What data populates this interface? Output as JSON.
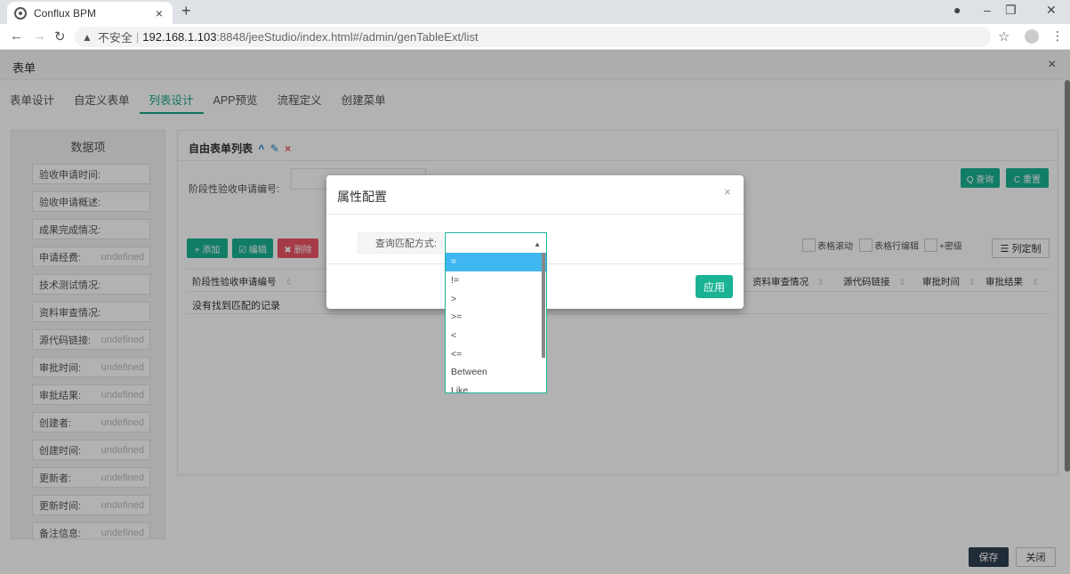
{
  "browser": {
    "tab_title": "Conflux BPM",
    "tab_close": "×",
    "new_tab": "+",
    "insecure_label": "不安全",
    "url_host": "192.168.1.103",
    "url_path": ":8848/jeeStudio/index.html#/admin/genTableExt/list"
  },
  "layer": {
    "title": "表单",
    "close": "×"
  },
  "tabs": [
    "表单设计",
    "自定义表单",
    "列表设计",
    "APP预览",
    "流程定义",
    "创建菜单"
  ],
  "left_panel": {
    "title": "数据项",
    "items": [
      {
        "name": "验收申请时间:",
        "value": ""
      },
      {
        "name": "验收申请概述:",
        "value": ""
      },
      {
        "name": "成果完成情况:",
        "value": ""
      },
      {
        "name": "申请经费:",
        "value": "undefined"
      },
      {
        "name": "技术测试情况:",
        "value": ""
      },
      {
        "name": "资料审查情况:",
        "value": ""
      },
      {
        "name": "源代码链接:",
        "value": "undefined"
      },
      {
        "name": "审批时间:",
        "value": "undefined"
      },
      {
        "name": "审批结果:",
        "value": "undefined"
      },
      {
        "name": "创建者:",
        "value": "undefined"
      },
      {
        "name": "创建时间:",
        "value": "undefined"
      },
      {
        "name": "更新者:",
        "value": "undefined"
      },
      {
        "name": "更新时间:",
        "value": "undefined"
      },
      {
        "name": "备注信息:",
        "value": "undefined"
      }
    ]
  },
  "main": {
    "title": "自由表单列表",
    "search_label": "阶段性验收申请编号:",
    "query_btn": "Q 查询",
    "reset_btn": "C 重置",
    "add_btn": "+ 添加",
    "edit_btn": "☑ 编辑",
    "delete_btn": "✖ 删除",
    "opt_scroll": "表格滚动",
    "opt_row_edit": "表格行编辑",
    "opt_dense": "+密级",
    "col_setting": "☰ 列定制",
    "headers": [
      "阶段性验收申请编号",
      "资料审查情况",
      "源代码链接",
      "审批时间",
      "审批结果"
    ],
    "no_record": "没有找到匹配的记录"
  },
  "modal": {
    "title": "属性配置",
    "close": "×",
    "match_label": "查询匹配方式:",
    "apply_btn": "应用"
  },
  "dropdown": {
    "options": [
      "=",
      "!=",
      ">",
      ">=",
      "<",
      "<=",
      "Between",
      "Like"
    ],
    "selected_index": 0
  },
  "footer": {
    "save": "保存",
    "close": "关闭"
  },
  "colors": {
    "accent_green": "#1ab394",
    "accent_blue": "#1c84c6",
    "danger_red": "#ed5565",
    "dropdown_highlight": "#40b7f0"
  }
}
